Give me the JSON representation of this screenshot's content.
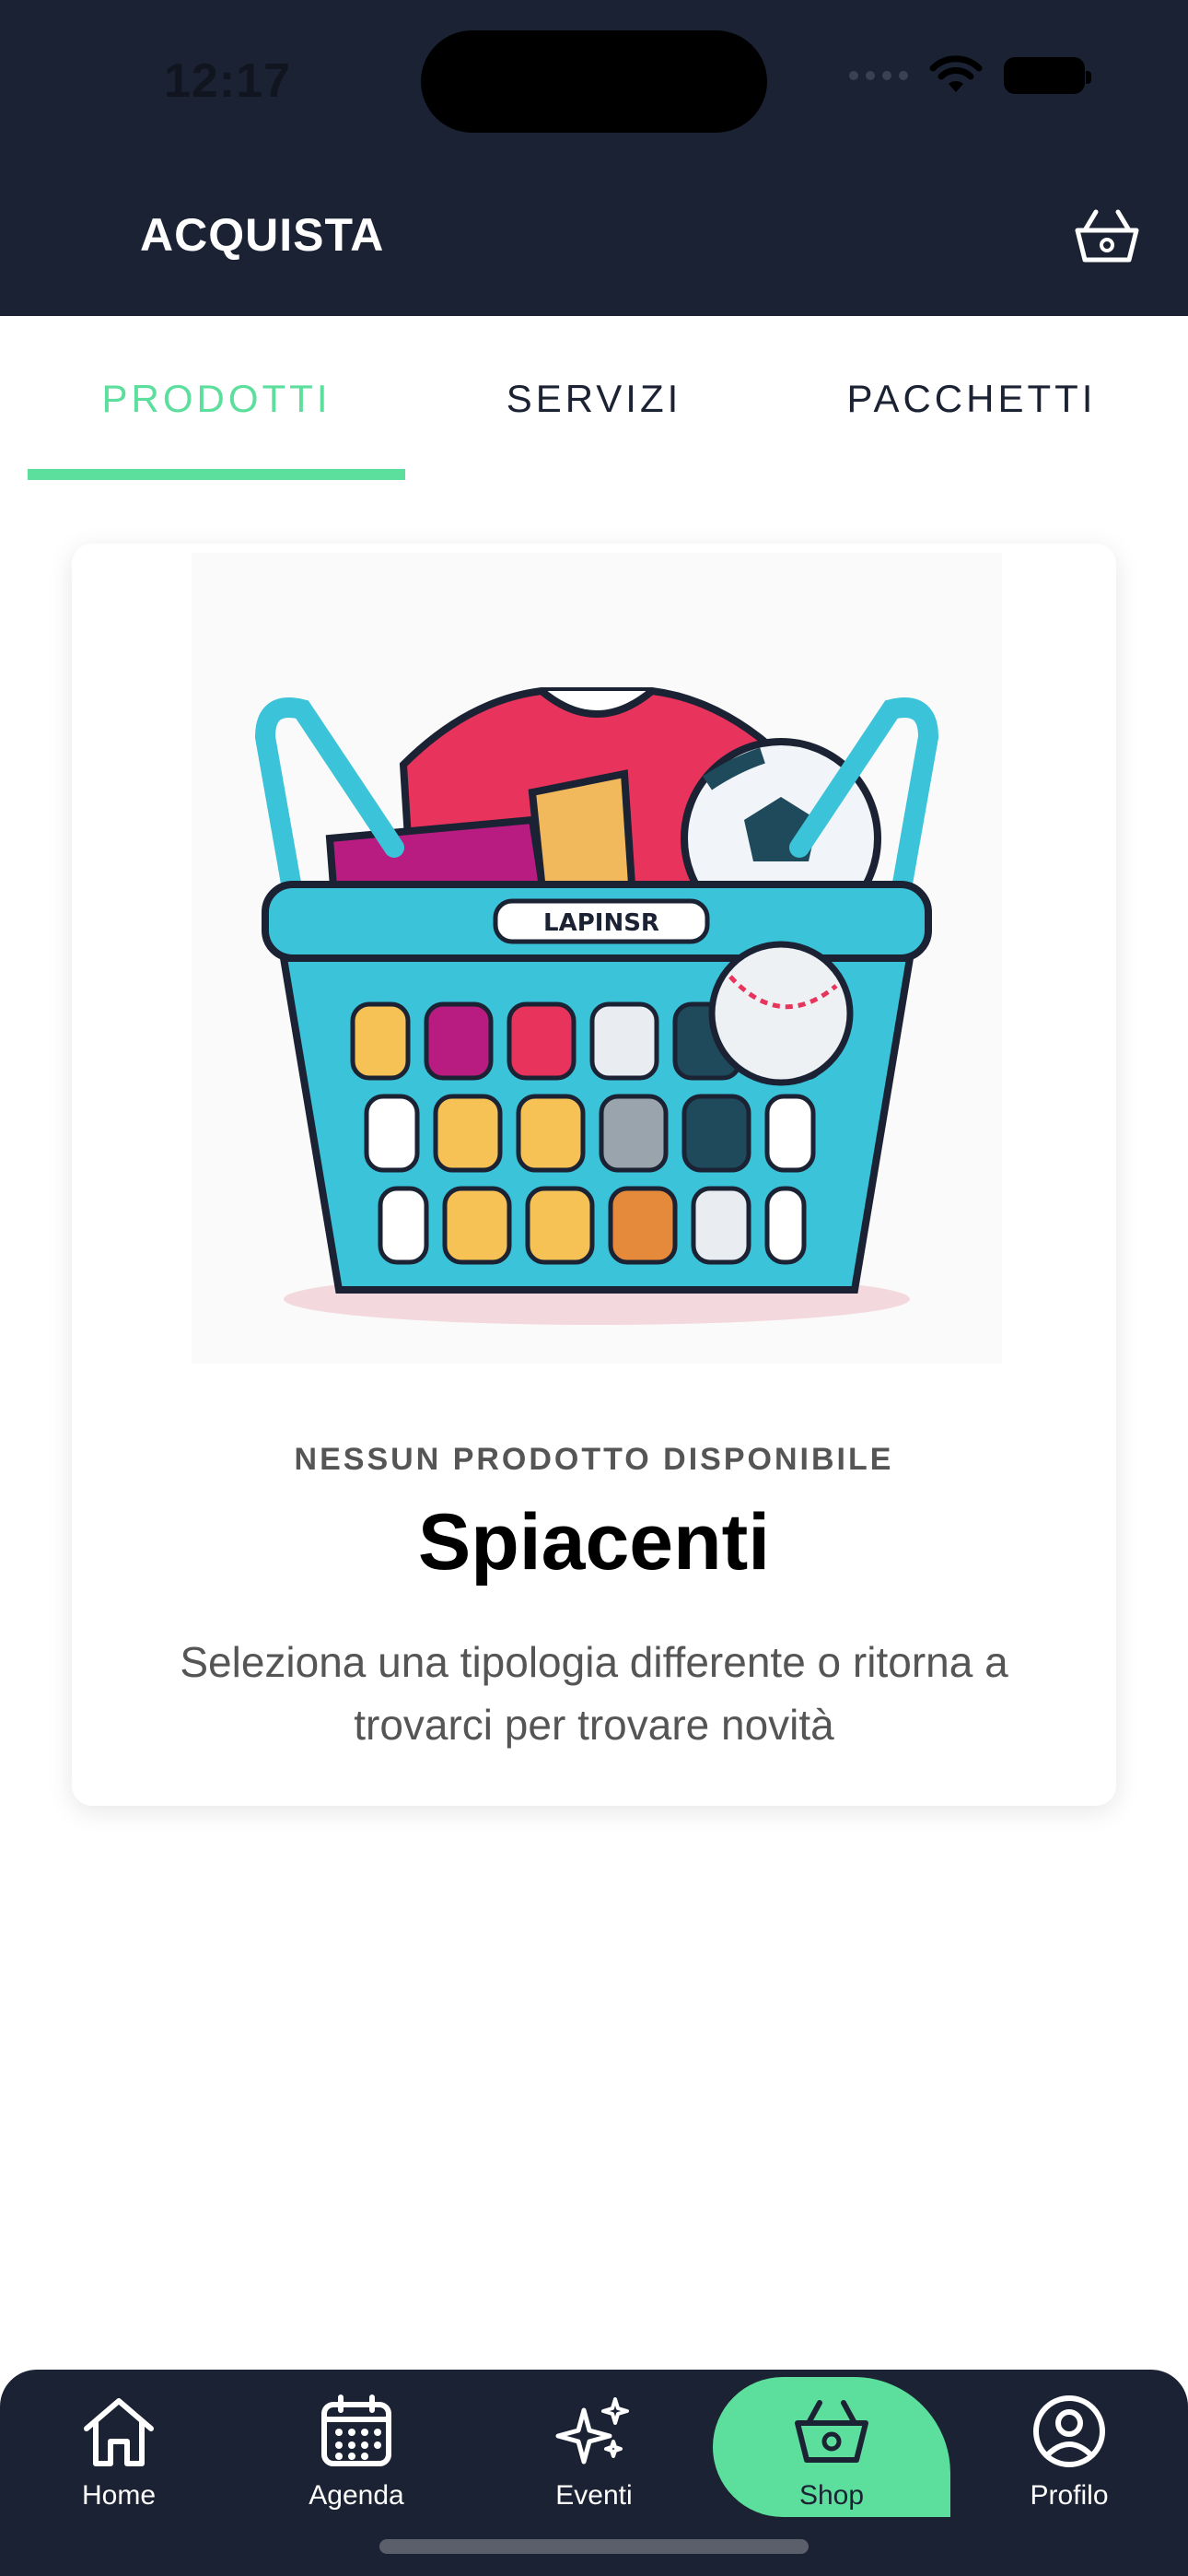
{
  "status_bar": {
    "time": "12:17"
  },
  "header": {
    "title": "ACQUISTA",
    "cart_icon": "basket-icon"
  },
  "tabs": [
    {
      "label": "PRODOTTI",
      "active": true
    },
    {
      "label": "SERVIZI",
      "active": false
    },
    {
      "label": "PACCHETTI",
      "active": false
    }
  ],
  "empty_state": {
    "illustration": "basket-with-sport-items-illustration",
    "basket_tag": "LAPINSR",
    "eyebrow": "NESSUN PRODOTTO DISPONIBILE",
    "title": "Spiacenti",
    "description": "Seleziona una tipologia differente o ritorna a trovarci per trovare novità"
  },
  "bottom_nav": [
    {
      "label": "Home",
      "icon": "home-icon",
      "active": false
    },
    {
      "label": "Agenda",
      "icon": "calendar-icon",
      "active": false
    },
    {
      "label": "Eventi",
      "icon": "sparkles-icon",
      "active": false
    },
    {
      "label": "Shop",
      "icon": "basket-icon",
      "active": true
    },
    {
      "label": "Profilo",
      "icon": "user-circle-icon",
      "active": false
    }
  ],
  "colors": {
    "primary_dark": "#1b2233",
    "accent": "#5cde9c",
    "text_muted": "#555555"
  }
}
